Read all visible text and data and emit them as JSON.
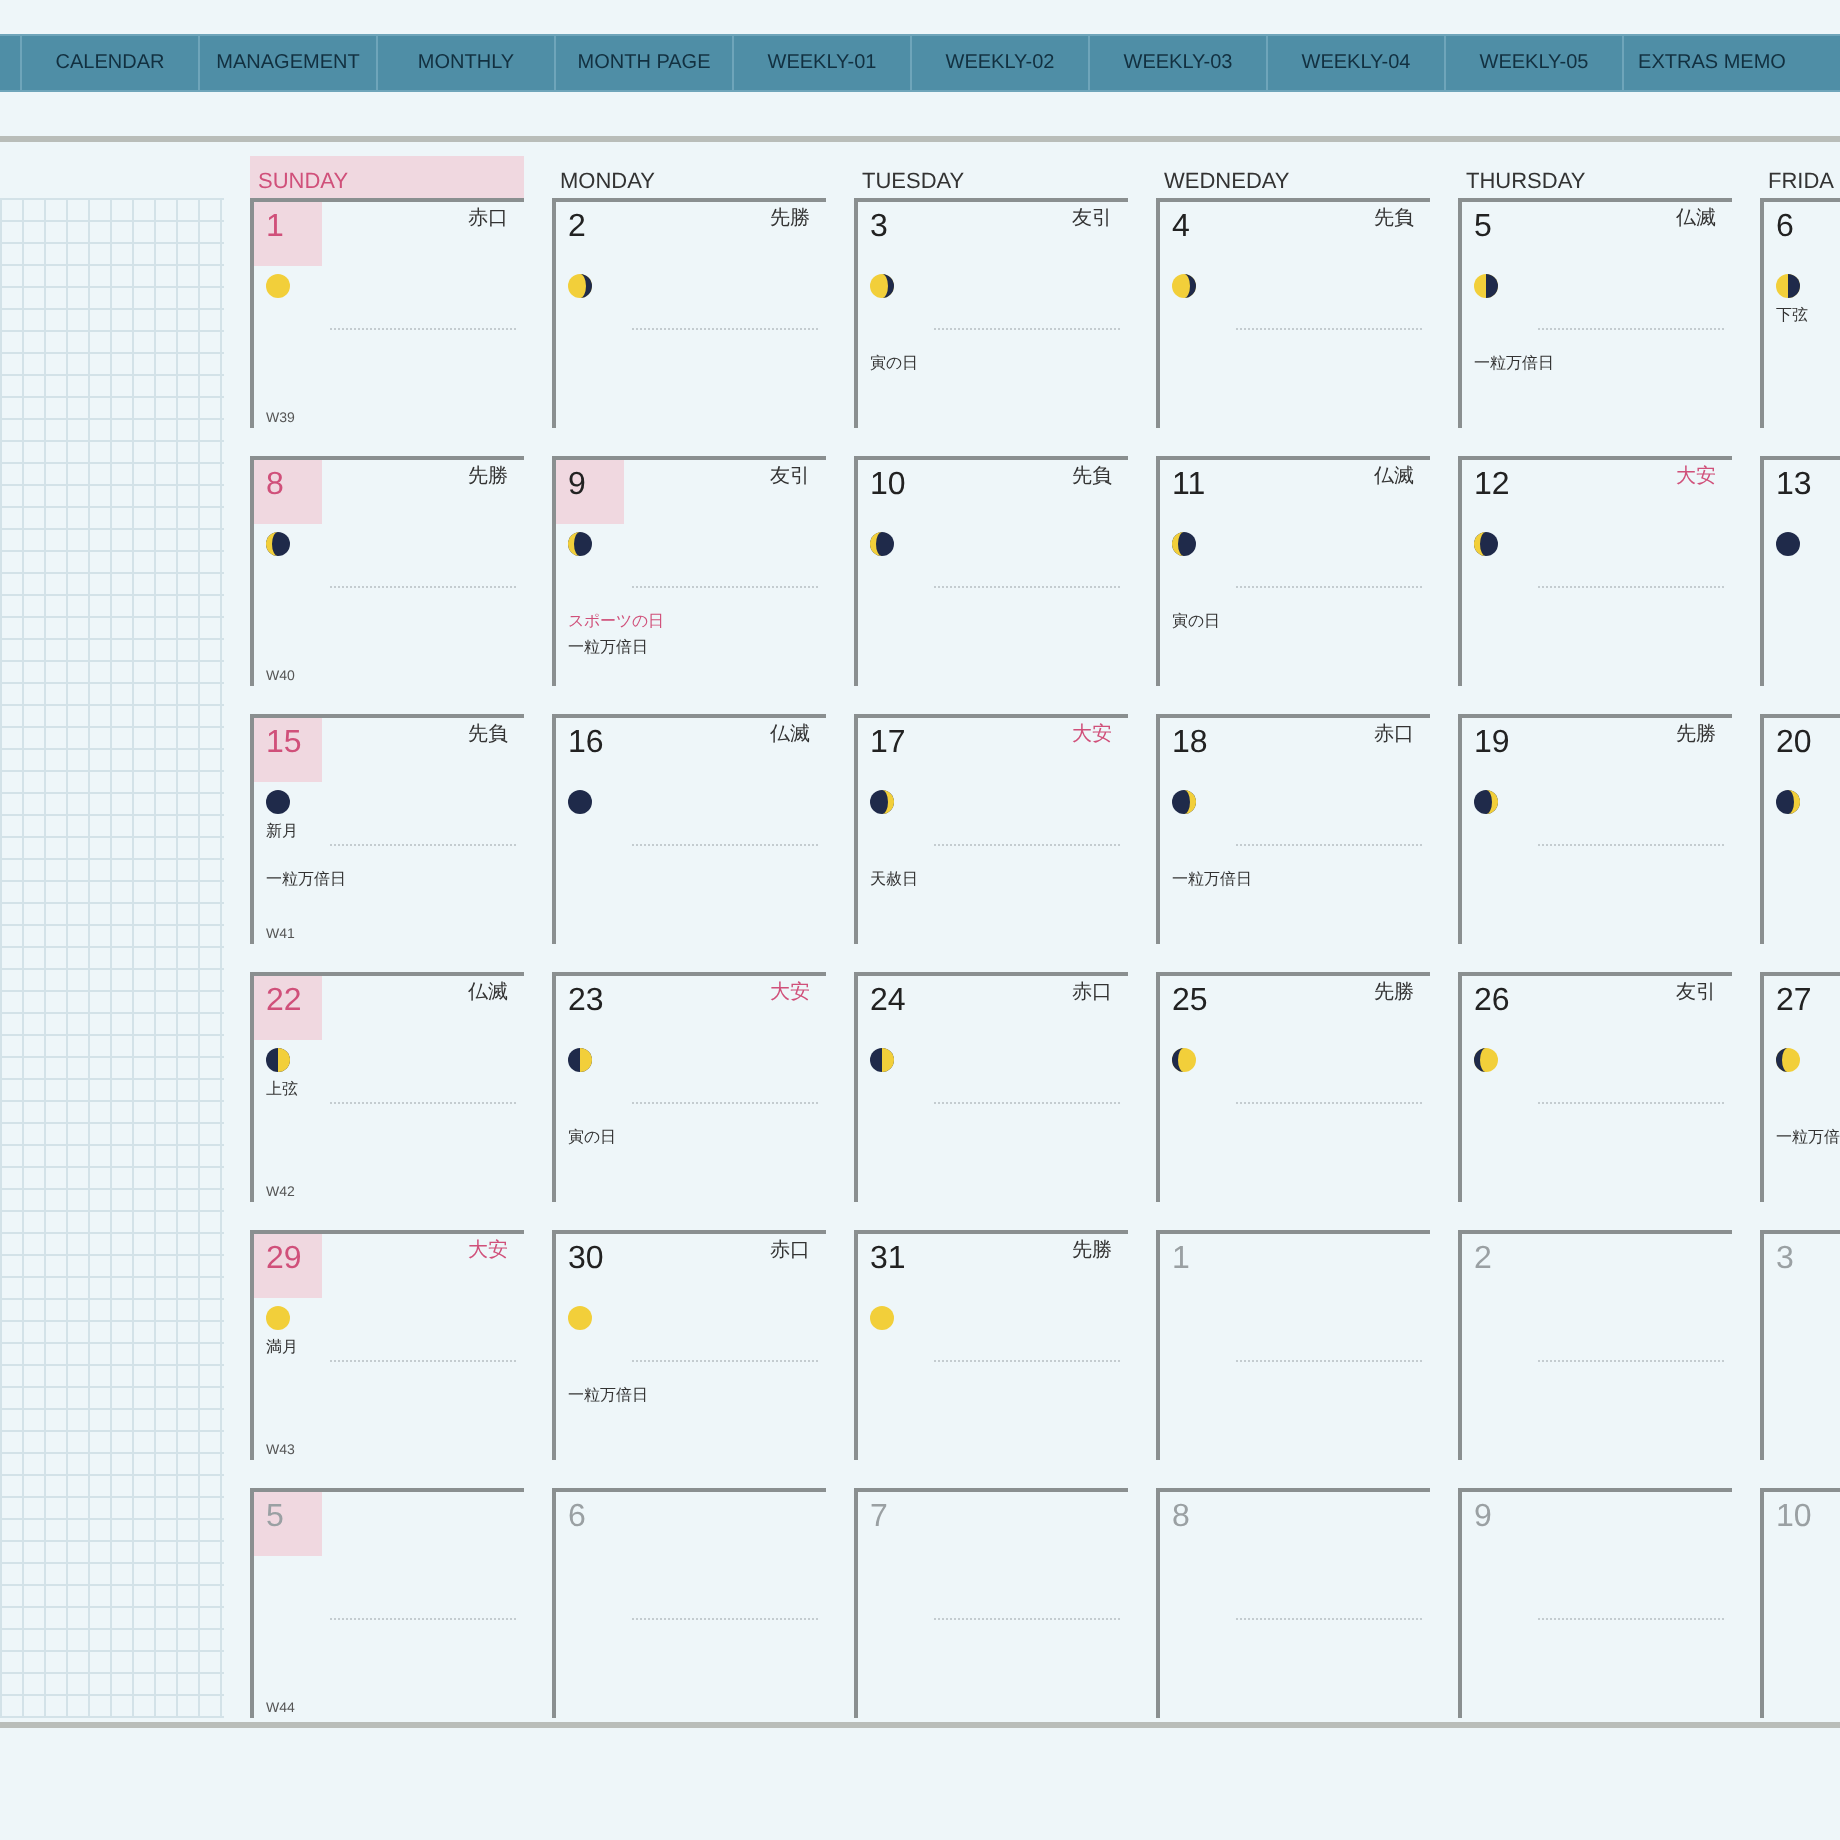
{
  "tabs": [
    "CALENDAR",
    "MANAGEMENT",
    "MONTHLY",
    "MONTH PAGE",
    "WEEKLY-01",
    "WEEKLY-02",
    "WEEKLY-03",
    "WEEKLY-04",
    "WEEKLY-05",
    "EXTRAS MEMO"
  ],
  "weekdays": [
    {
      "label": "SUNDAY",
      "highlighted": true
    },
    {
      "label": "MONDAY",
      "highlighted": false
    },
    {
      "label": "TUESDAY",
      "highlighted": false
    },
    {
      "label": "WEDNEDAY",
      "highlighted": false
    },
    {
      "label": "THURSDAY",
      "highlighted": false
    },
    {
      "label": "FRIDA",
      "highlighted": false
    }
  ],
  "weeks": [
    [
      {
        "day": "1",
        "rokuyo": {
          "text": "赤口",
          "kind": "normal"
        },
        "moon": {
          "kind": "full"
        },
        "week": "W39",
        "highlighted": true,
        "muted": false
      },
      {
        "day": "2",
        "rokuyo": {
          "text": "先勝",
          "kind": "normal"
        },
        "moon": {
          "kind": "waning-gibbous"
        },
        "highlighted": false,
        "muted": false
      },
      {
        "day": "3",
        "rokuyo": {
          "text": "友引",
          "kind": "normal"
        },
        "moon": {
          "kind": "waning-gibbous"
        },
        "notes": [
          {
            "text": "寅の日",
            "kind": "normal"
          }
        ],
        "highlighted": false,
        "muted": false
      },
      {
        "day": "4",
        "rokuyo": {
          "text": "先負",
          "kind": "normal"
        },
        "moon": {
          "kind": "waning-gibbous"
        },
        "highlighted": false,
        "muted": false
      },
      {
        "day": "5",
        "rokuyo": {
          "text": "仏滅",
          "kind": "normal"
        },
        "moon": {
          "kind": "last-quarter"
        },
        "notes": [
          {
            "text": "一粒万倍日",
            "kind": "normal"
          }
        ],
        "highlighted": false,
        "muted": false
      },
      {
        "day": "6",
        "moon": {
          "kind": "last-quarter",
          "label": "下弦"
        },
        "highlighted": false,
        "muted": false
      }
    ],
    [
      {
        "day": "8",
        "rokuyo": {
          "text": "先勝",
          "kind": "normal"
        },
        "moon": {
          "kind": "waning-crescent"
        },
        "week": "W40",
        "highlighted": true,
        "muted": false
      },
      {
        "day": "9",
        "rokuyo": {
          "text": "友引",
          "kind": "normal"
        },
        "moon": {
          "kind": "waning-crescent"
        },
        "notes": [
          {
            "text": "スポーツの日",
            "kind": "holiday"
          },
          {
            "text": "一粒万倍日",
            "kind": "normal"
          }
        ],
        "highlighted": true,
        "muted": false
      },
      {
        "day": "10",
        "rokuyo": {
          "text": "先負",
          "kind": "normal"
        },
        "moon": {
          "kind": "waning-crescent"
        },
        "highlighted": false,
        "muted": false
      },
      {
        "day": "11",
        "rokuyo": {
          "text": "仏滅",
          "kind": "normal"
        },
        "moon": {
          "kind": "waning-crescent"
        },
        "notes": [
          {
            "text": "寅の日",
            "kind": "normal"
          }
        ],
        "highlighted": false,
        "muted": false
      },
      {
        "day": "12",
        "rokuyo": {
          "text": "大安",
          "kind": "lucky"
        },
        "moon": {
          "kind": "waning-crescent"
        },
        "highlighted": false,
        "muted": false
      },
      {
        "day": "13",
        "moon": {
          "kind": "new"
        },
        "highlighted": false,
        "muted": false
      }
    ],
    [
      {
        "day": "15",
        "rokuyo": {
          "text": "先負",
          "kind": "normal"
        },
        "moon": {
          "kind": "new",
          "label": "新月"
        },
        "notes": [
          {
            "text": "一粒万倍日",
            "kind": "normal"
          }
        ],
        "week": "W41",
        "highlighted": true,
        "muted": false
      },
      {
        "day": "16",
        "rokuyo": {
          "text": "仏滅",
          "kind": "normal"
        },
        "moon": {
          "kind": "new"
        },
        "highlighted": false,
        "muted": false
      },
      {
        "day": "17",
        "rokuyo": {
          "text": "大安",
          "kind": "lucky"
        },
        "moon": {
          "kind": "waxing-crescent"
        },
        "notes": [
          {
            "text": "天赦日",
            "kind": "normal"
          }
        ],
        "highlighted": false,
        "muted": false
      },
      {
        "day": "18",
        "rokuyo": {
          "text": "赤口",
          "kind": "normal"
        },
        "moon": {
          "kind": "waxing-crescent"
        },
        "notes": [
          {
            "text": "一粒万倍日",
            "kind": "normal"
          }
        ],
        "highlighted": false,
        "muted": false
      },
      {
        "day": "19",
        "rokuyo": {
          "text": "先勝",
          "kind": "normal"
        },
        "moon": {
          "kind": "waxing-crescent"
        },
        "highlighted": false,
        "muted": false
      },
      {
        "day": "20",
        "moon": {
          "kind": "waxing-crescent"
        },
        "highlighted": false,
        "muted": false
      }
    ],
    [
      {
        "day": "22",
        "rokuyo": {
          "text": "仏滅",
          "kind": "normal"
        },
        "moon": {
          "kind": "first-quarter",
          "label": "上弦"
        },
        "week": "W42",
        "highlighted": true,
        "muted": false
      },
      {
        "day": "23",
        "rokuyo": {
          "text": "大安",
          "kind": "lucky"
        },
        "moon": {
          "kind": "first-quarter"
        },
        "notes": [
          {
            "text": "寅の日",
            "kind": "normal"
          }
        ],
        "highlighted": false,
        "muted": false
      },
      {
        "day": "24",
        "rokuyo": {
          "text": "赤口",
          "kind": "normal"
        },
        "moon": {
          "kind": "first-quarter"
        },
        "highlighted": false,
        "muted": false
      },
      {
        "day": "25",
        "rokuyo": {
          "text": "先勝",
          "kind": "normal"
        },
        "moon": {
          "kind": "waxing-gibbous"
        },
        "highlighted": false,
        "muted": false
      },
      {
        "day": "26",
        "rokuyo": {
          "text": "友引",
          "kind": "normal"
        },
        "moon": {
          "kind": "waxing-gibbous"
        },
        "highlighted": false,
        "muted": false
      },
      {
        "day": "27",
        "moon": {
          "kind": "waxing-gibbous"
        },
        "notes": [
          {
            "text": "一粒万倍",
            "kind": "normal"
          }
        ],
        "highlighted": false,
        "muted": false
      }
    ],
    [
      {
        "day": "29",
        "rokuyo": {
          "text": "大安",
          "kind": "lucky"
        },
        "moon": {
          "kind": "full",
          "label": "満月"
        },
        "week": "W43",
        "highlighted": true,
        "muted": false
      },
      {
        "day": "30",
        "rokuyo": {
          "text": "赤口",
          "kind": "normal"
        },
        "moon": {
          "kind": "full"
        },
        "notes": [
          {
            "text": "一粒万倍日",
            "kind": "normal"
          }
        ],
        "highlighted": false,
        "muted": false
      },
      {
        "day": "31",
        "rokuyo": {
          "text": "先勝",
          "kind": "normal"
        },
        "moon": {
          "kind": "full"
        },
        "highlighted": false,
        "muted": false
      },
      {
        "day": "1",
        "highlighted": false,
        "muted": true
      },
      {
        "day": "2",
        "highlighted": false,
        "muted": true
      },
      {
        "day": "3",
        "highlighted": false,
        "muted": true
      }
    ],
    [
      {
        "day": "5",
        "week": "W44",
        "highlighted": true,
        "muted": true
      },
      {
        "day": "6",
        "highlighted": false,
        "muted": true
      },
      {
        "day": "7",
        "highlighted": false,
        "muted": true
      },
      {
        "day": "8",
        "highlighted": false,
        "muted": true
      },
      {
        "day": "9",
        "highlighted": false,
        "muted": true
      },
      {
        "day": "10",
        "highlighted": false,
        "muted": true
      }
    ]
  ]
}
